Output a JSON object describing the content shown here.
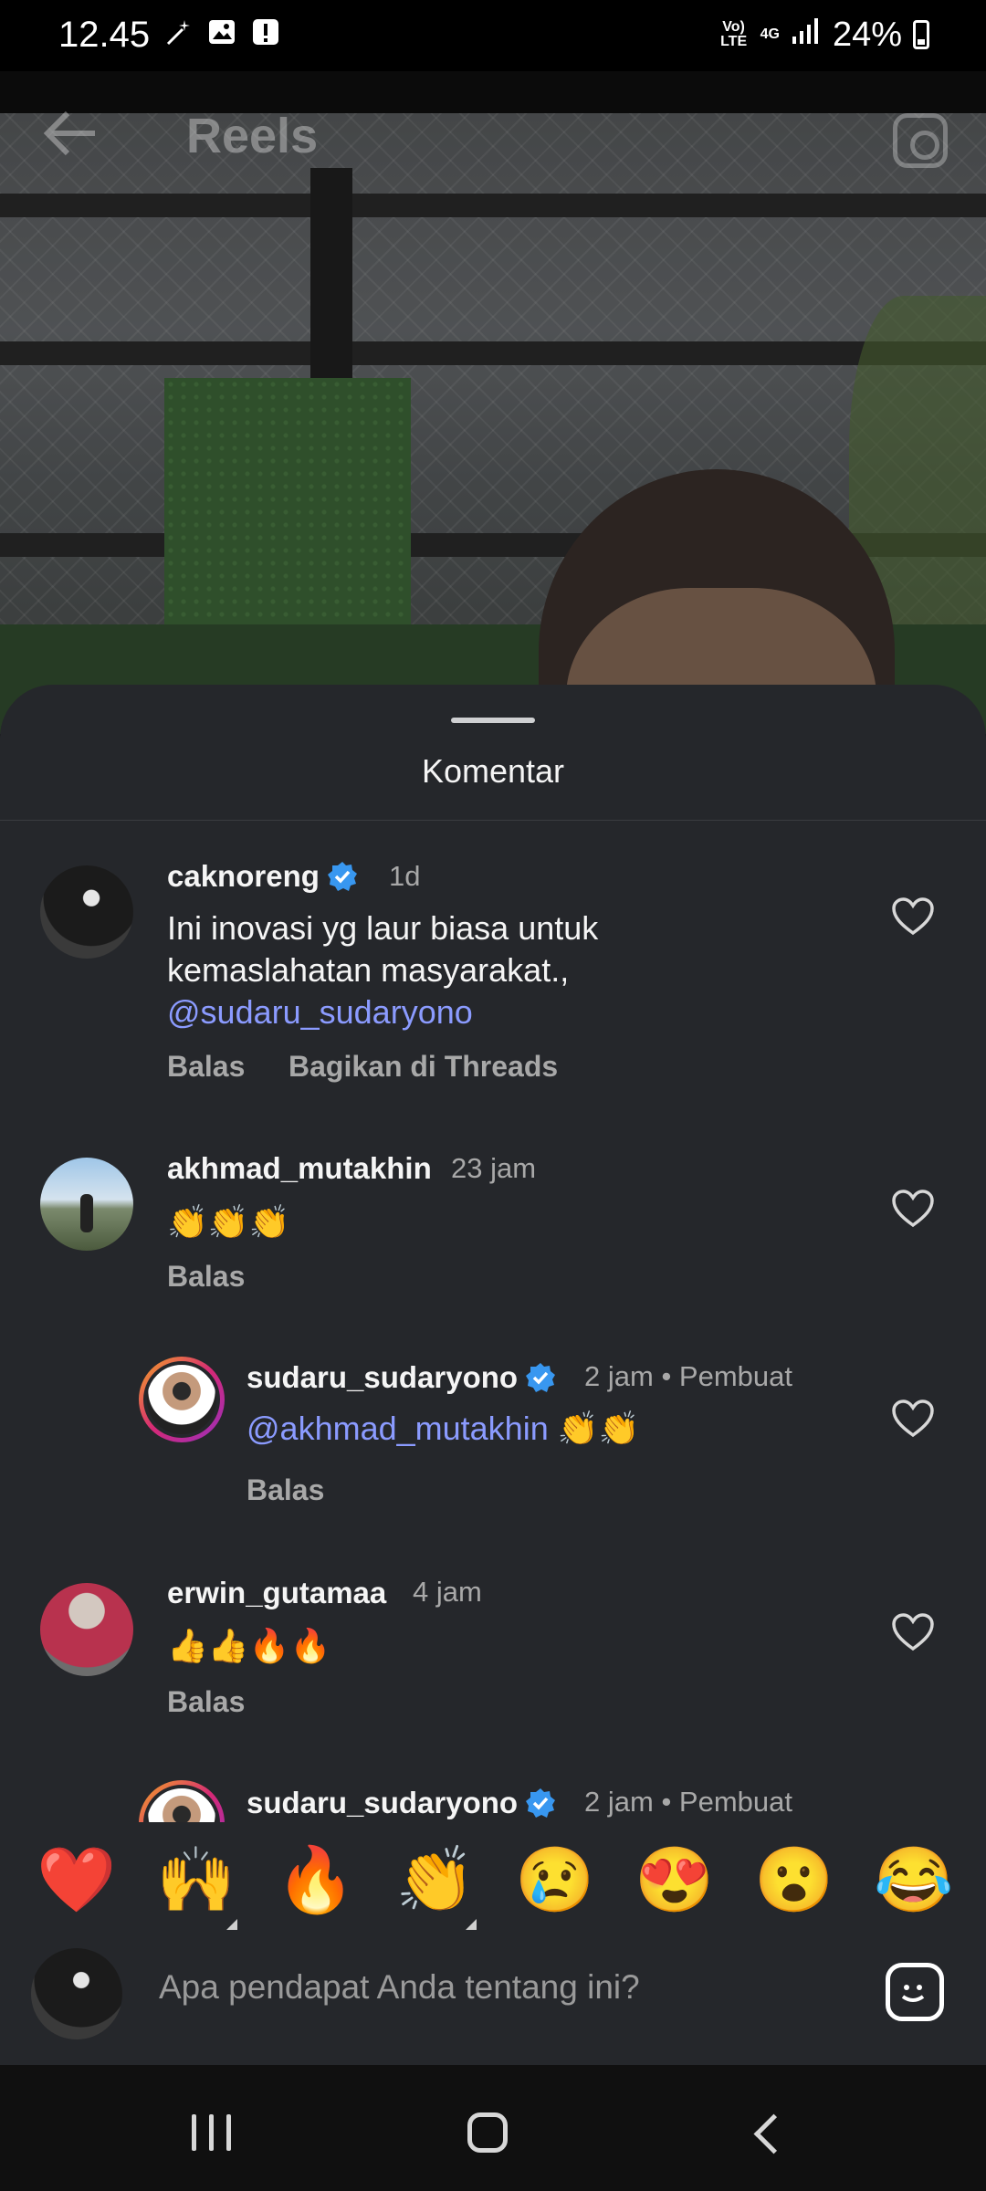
{
  "status_bar": {
    "time": "12.45",
    "volte": "Vo) LTE",
    "network": "4G",
    "battery": "24%",
    "icons": [
      "magic-wand-icon",
      "gallery-icon",
      "alert-icon",
      "signal-icon",
      "battery-icon"
    ]
  },
  "reels_header": {
    "title": "Reels",
    "back_icon": "arrow-left-icon",
    "camera_icon": "camera-icon"
  },
  "sheet": {
    "title": "Komentar"
  },
  "comments": [
    {
      "username": "caknoreng",
      "verified": true,
      "time": "1d",
      "text": "Ini inovasi yg laur biasa untuk kemaslahatan masyarakat.,",
      "mention": "@sudaru_sudaryono",
      "reply_label": "Balas",
      "share_label": "Bagikan di Threads"
    },
    {
      "username": "akhmad_mutakhin",
      "verified": false,
      "time": "23 jam",
      "text": "👏👏👏",
      "reply_label": "Balas"
    },
    {
      "username": "sudaru_sudaryono",
      "verified": true,
      "time": "2 jam",
      "creator_label": "• Pembuat",
      "mention": "@akhmad_mutakhin",
      "text": " 👏👏",
      "reply_label": "Balas"
    },
    {
      "username": "erwin_gutamaa",
      "verified": false,
      "time": "4 jam",
      "text": "👍👍🔥🔥",
      "reply_label": "Balas"
    },
    {
      "username": "sudaru_sudaryono",
      "verified": true,
      "time": "2 jam",
      "creator_label": "• Pembuat"
    }
  ],
  "emoji_reactions": [
    "❤️",
    "🙌",
    "🔥",
    "👏",
    "😢",
    "😍",
    "😮",
    "😂"
  ],
  "composer": {
    "placeholder": "Apa pendapat Anda tentang ini?",
    "sticker_icon": "sticker-icon"
  },
  "nav": {
    "icons": [
      "recent-apps-icon",
      "home-icon",
      "back-icon"
    ]
  },
  "colors": {
    "sheet_bg": "#25272b",
    "mention": "#8b9bff",
    "verified": "#3897f0",
    "secondary_text": "#a8a8a8"
  }
}
